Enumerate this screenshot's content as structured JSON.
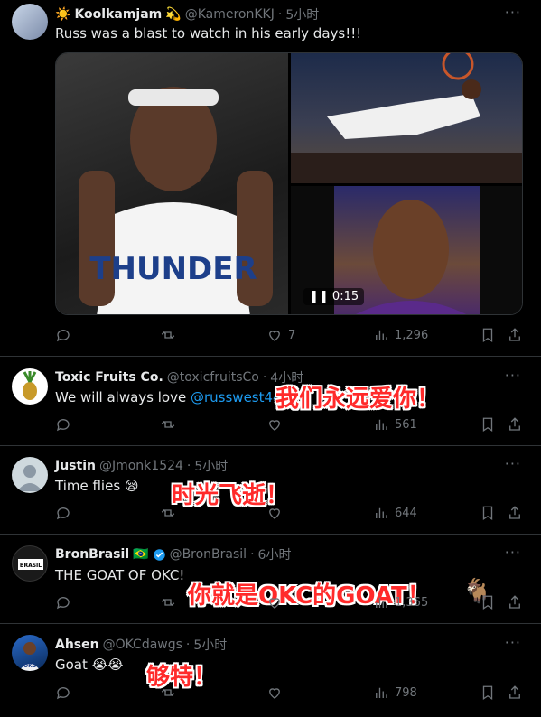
{
  "tweets": [
    {
      "name": "Koolkamjam",
      "name_prefix_emoji": "☀️",
      "name_suffix_emoji": "💫",
      "handle": "@KameronKKJ",
      "time": "5小时",
      "text": "Russ was a blast to watch in his early days!!!",
      "media": {
        "jersey_text": "THUNDER",
        "video_time": "0:15"
      },
      "stats": {
        "reply": "",
        "retweet": "",
        "like": "7",
        "views": "1,296"
      }
    },
    {
      "name": "Toxic Fruits Co.",
      "handle": "@toxicfruitsCo",
      "time": "4小时",
      "text_before": "We will always love ",
      "mention": "@russwest44",
      "overlay": "我们永远爱你！",
      "stats": {
        "reply": "",
        "retweet": "",
        "like": "",
        "views": "561"
      }
    },
    {
      "name": "Justin",
      "handle": "@Jmonk1524",
      "time": "5小时",
      "text": "Time flies 😪",
      "overlay": "时光飞逝！",
      "stats": {
        "reply": "",
        "retweet": "",
        "like": "",
        "views": "644"
      }
    },
    {
      "name": "BronBrasil",
      "flag": "🇧🇷",
      "handle": "@BronBrasil",
      "time": "6小时",
      "text": "THE GOAT OF OKC!",
      "overlay": "你就是OKC的GOAT！",
      "overlay_emoji": "🐐",
      "avatar_text": "BRASIL",
      "stats": {
        "reply": "",
        "retweet": "",
        "like": "",
        "views": "1,365"
      }
    },
    {
      "name": "Ahsen",
      "handle": "@OKCdawgs",
      "time": "5小时",
      "text": "Goat 😭😭",
      "overlay": "够特！",
      "avatar_text": "OKC",
      "stats": {
        "reply": "",
        "retweet": "",
        "like": "",
        "views": "798"
      }
    }
  ],
  "separator": "·",
  "more_icon": "···",
  "colors": {
    "accent": "#1d9bf0",
    "muted": "#71767b",
    "overlay_red": "#ff2a2a",
    "bg": "#000000"
  }
}
